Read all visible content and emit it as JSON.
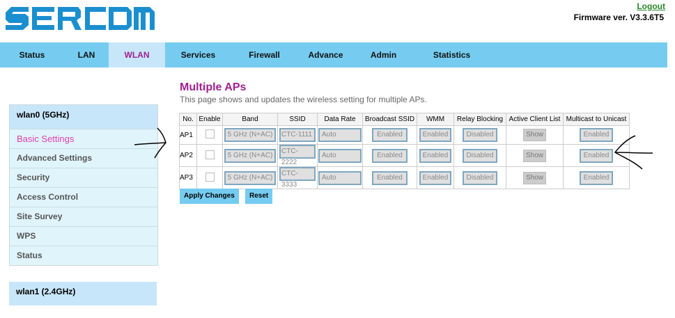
{
  "header": {
    "logo": "SERCOM",
    "logout": "Logout",
    "firmware": "Firmware ver. V3.3.6T5"
  },
  "nav": [
    "Status",
    "LAN",
    "WLAN",
    "Services",
    "Firewall",
    "Advance",
    "Admin",
    "Statistics"
  ],
  "nav_active": "WLAN",
  "sidebar": {
    "wlan0": {
      "title": "wlan0 (5GHz)",
      "items": [
        "Basic Settings",
        "Advanced Settings",
        "Security",
        "Access Control",
        "Site Survey",
        "WPS",
        "Status"
      ],
      "selected": "Basic Settings"
    },
    "wlan1": {
      "title": "wlan1 (2.4GHz)"
    }
  },
  "main": {
    "title": "Multiple APs",
    "description": "This page shows and updates the wireless setting for multiple APs.",
    "columns": [
      "No.",
      "Enable",
      "Band",
      "SSID",
      "Data Rate",
      "Broadcast SSID",
      "WMM",
      "Relay Blocking",
      "Active Client List",
      "Multicast to Unicast"
    ],
    "rows": [
      {
        "no": "AP1",
        "enabled": false,
        "band": "5 GHz (N+AC)",
        "ssid": "CTC-1111",
        "rate": "Auto",
        "broadcast": "Enabled",
        "wmm": "Enabled",
        "relay": "Disabled",
        "clients": "Show",
        "multicast": "Enabled"
      },
      {
        "no": "AP2",
        "enabled": false,
        "band": "5 GHz (N+AC)",
        "ssid": "CTC-2222",
        "rate": "Auto",
        "broadcast": "Enabled",
        "wmm": "Enabled",
        "relay": "Disabled",
        "clients": "Show",
        "multicast": "Enabled"
      },
      {
        "no": "AP3",
        "enabled": false,
        "band": "5 GHz (N+AC)",
        "ssid": "CTC-3333",
        "rate": "Auto",
        "broadcast": "Enabled",
        "wmm": "Enabled",
        "relay": "Disabled",
        "clients": "Show",
        "multicast": "Enabled"
      }
    ],
    "apply": "Apply Changes",
    "reset": "Reset"
  },
  "colors": {
    "brand": "#1a8fd0",
    "nav": "#76ccf0",
    "active": "#c8e6fa",
    "title": "#a0208f"
  }
}
